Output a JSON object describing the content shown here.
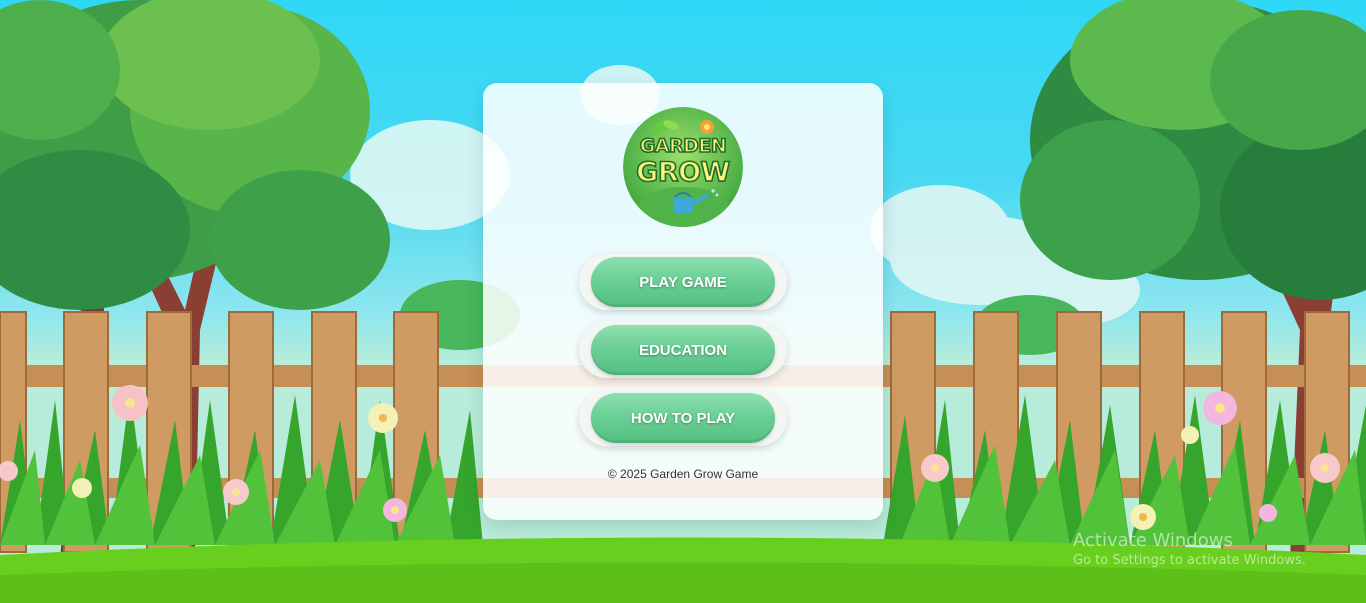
{
  "menu": {
    "logo": {
      "line1": "GARDEN",
      "line2": "GROW"
    },
    "buttons": [
      {
        "label": "PLAY GAME"
      },
      {
        "label": "EDUCATION"
      },
      {
        "label": "HOW TO PLAY"
      }
    ],
    "footer": "© 2025 Garden Grow Game"
  },
  "watermark": {
    "title": "Activate Windows",
    "subtitle": "Go to Settings to activate Windows."
  },
  "colors": {
    "button": "#6bcf96",
    "sky": "#2fd8f7",
    "grass": "#6ad31f",
    "fence": "#c9955c"
  },
  "icons": [
    "leaf-icon",
    "flower-icon",
    "watering-can-icon"
  ]
}
